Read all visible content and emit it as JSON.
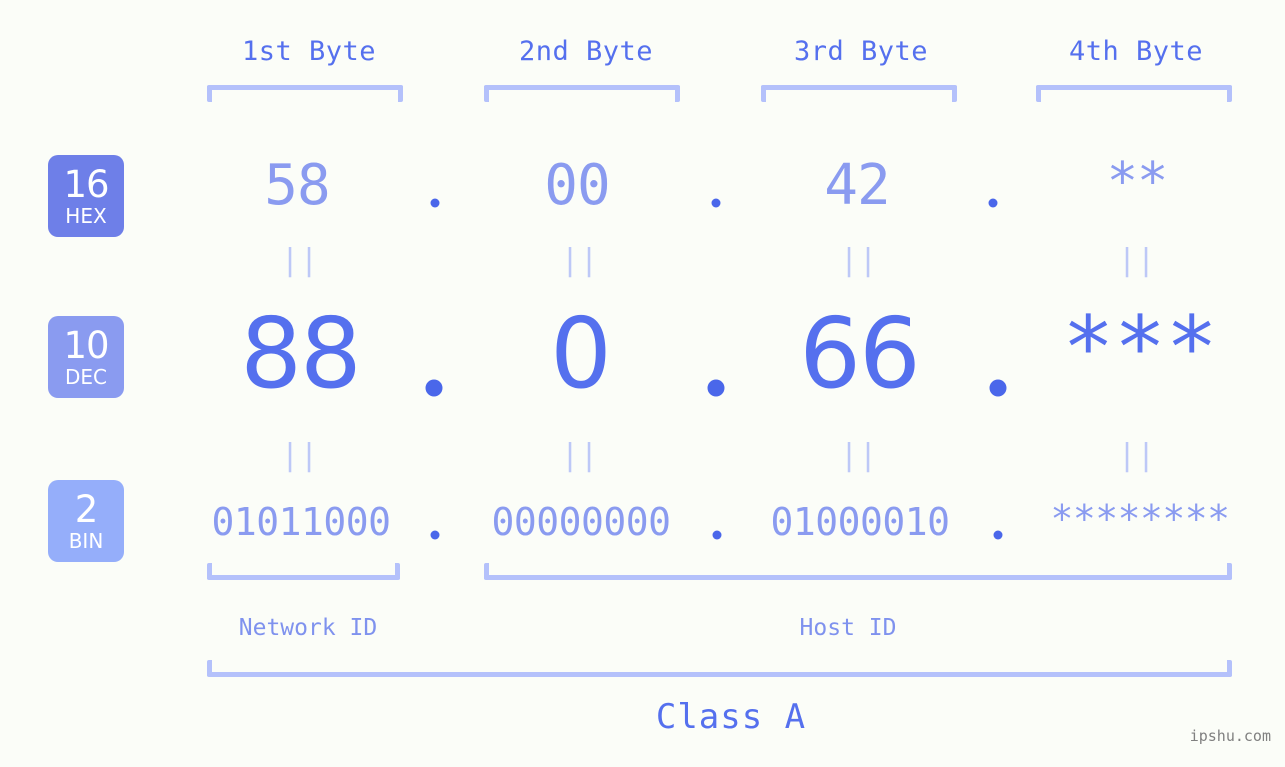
{
  "background": "#fbfdf8",
  "colors": {
    "accent_strong": "#5570ee",
    "accent_mid": "#8a9bf0",
    "accent_light": "#b4c1fb",
    "accent_faint": "#bdc8f7",
    "badge_hex": "#6e7fe8",
    "badge_dec": "#8a9bf0",
    "badge_bin": "#95aefa",
    "watermark": "#808080"
  },
  "byte_headers": [
    {
      "label": "1st Byte"
    },
    {
      "label": "2nd Byte"
    },
    {
      "label": "3rd Byte"
    },
    {
      "label": "4th Byte"
    }
  ],
  "rows": [
    {
      "badge_number": "16",
      "badge_base": "HEX",
      "values": [
        "58",
        "00",
        "42",
        "**"
      ],
      "separators": [
        ".",
        ".",
        "."
      ]
    },
    {
      "badge_number": "10",
      "badge_base": "DEC",
      "values": [
        "88",
        "0",
        "66",
        "***"
      ],
      "separators": [
        ".",
        ".",
        "."
      ]
    },
    {
      "badge_number": "2",
      "badge_base": "BIN",
      "values": [
        "01011000",
        "00000000",
        "01000010",
        "********"
      ],
      "separators": [
        ".",
        ".",
        "."
      ]
    }
  ],
  "equals_glyph": "||",
  "sections": [
    {
      "label": "Network ID"
    },
    {
      "label": "Host ID"
    }
  ],
  "class": {
    "label": "Class A"
  },
  "watermark": {
    "text": "ipshu.com"
  },
  "chart_data": {
    "type": "table",
    "title": "IPv4 address representation by byte and numeric base",
    "columns": [
      "1st Byte",
      "2nd Byte",
      "3rd Byte",
      "4th Byte"
    ],
    "rows": [
      {
        "base": "HEX",
        "radix": 16,
        "cells": [
          "58",
          "00",
          "42",
          "**"
        ]
      },
      {
        "base": "DEC",
        "radix": 10,
        "cells": [
          "88",
          "0",
          "66",
          "***"
        ]
      },
      {
        "base": "BIN",
        "radix": 2,
        "cells": [
          "01011000",
          "00000000",
          "01000010",
          "********"
        ]
      }
    ],
    "network_id_bytes": 1,
    "host_id_bytes": 3,
    "address_class": "Class A"
  }
}
